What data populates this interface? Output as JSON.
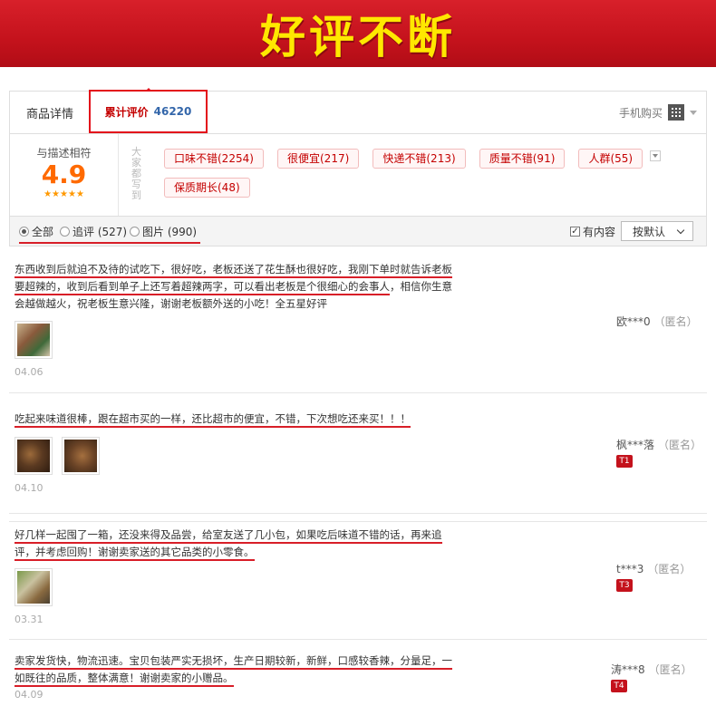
{
  "banner": {
    "title": "好评不断"
  },
  "tabs": {
    "detail": "商品详情",
    "reviews_label": "累计评价",
    "reviews_count": "46220",
    "mobile_buy": "手机购买"
  },
  "rating": {
    "label": "与描述相符",
    "score": "4.9",
    "stars": "★★★★★",
    "side_label": "大家都写到"
  },
  "tags": [
    "口味不错(2254)",
    "很便宜(217)",
    "快递不错(213)",
    "质量不错(91)",
    "人群(55)",
    "保质期长(48)"
  ],
  "filters": {
    "all": "全部",
    "follow_up": "追评 (527)",
    "pictures": "图片 (990)",
    "has_content": "有内容",
    "sort": "按默认"
  },
  "reviews": [
    {
      "text_a": "东西收到后就迫不及待的试吃下，很好吃，老板还送了花生酥也很好吃，我刚下单时就告诉老板要超辣的，收到后看到单子上还写着超辣两字，可以看出老板是个很细心的会事人",
      "text_b": "，相信你生意会越做越火，祝老板生意兴隆，谢谢老板额外送的小吃！全五星好评",
      "date": "04.06",
      "user": "欧***0",
      "anon": "（匿名）",
      "badge": ""
    },
    {
      "text_a": "吃起来味道很棒，跟在超市买的一样，还比超市的便宜，不错，下次想吃还来买！！！",
      "text_b": "",
      "date": "04.10",
      "user": "枫***落",
      "anon": "（匿名）",
      "badge": "T1"
    },
    {
      "text_a": "好几样一起囤了一箱，还没来得及品尝，给室友送了几小包，如果吃后味道不错的话，再来追评，并考虑回购！谢谢卖家送的其它品类的小零食。",
      "text_b": "",
      "date": "03.31",
      "user": "t***3",
      "anon": "（匿名）",
      "badge": "T3"
    },
    {
      "text_a": "卖家发货快，物流迅速。宝贝包装严实无损坏，生产日期较新，新鲜，口感较香辣，分量足，一如既往的品质，整体满意！谢谢卖家的小赠品。",
      "text_b": "",
      "date": "04.09",
      "user": "涛***8",
      "anon": "（匿名）",
      "badge": "T4"
    }
  ]
}
